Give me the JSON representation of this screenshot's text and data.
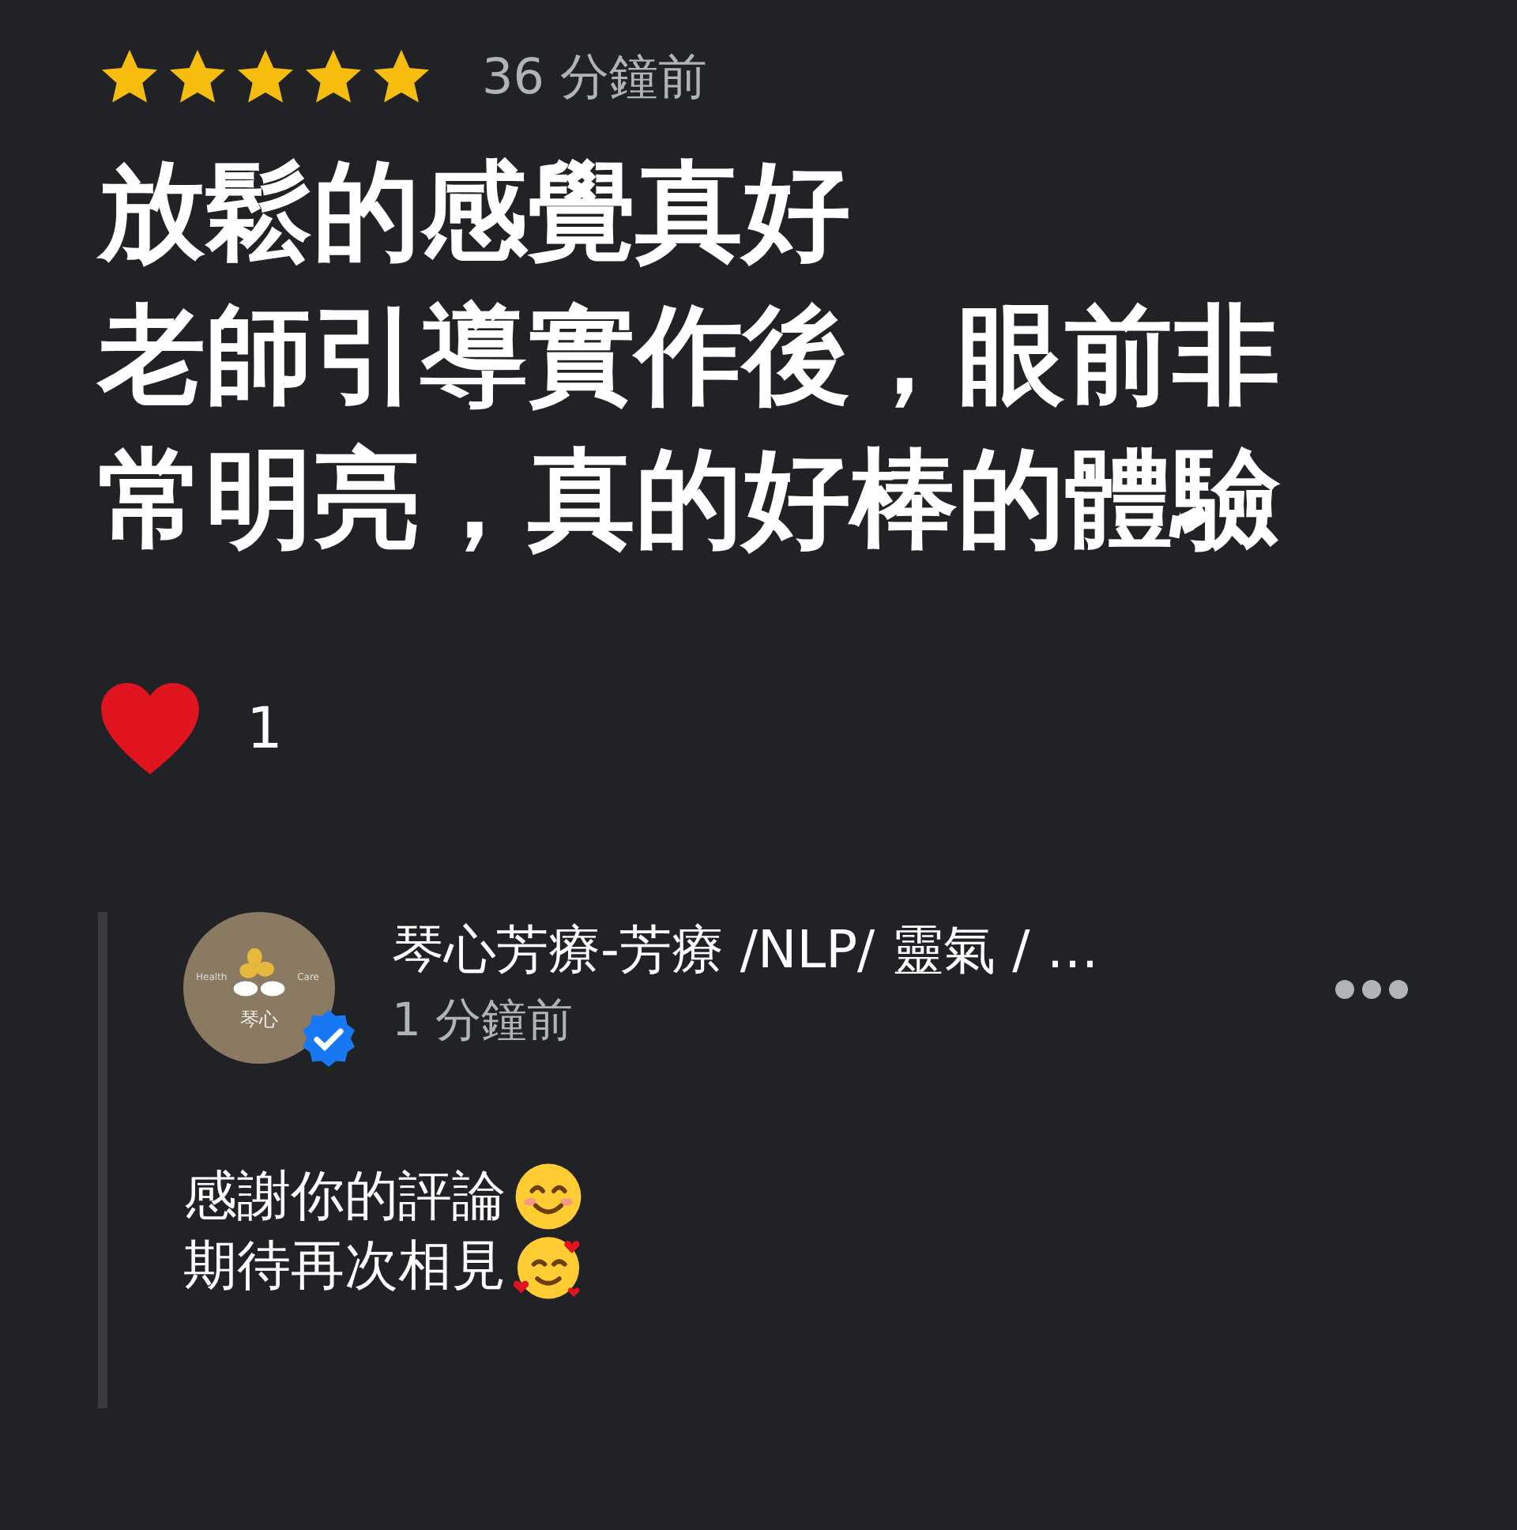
{
  "review": {
    "stars": 5,
    "time": "36 分鐘前",
    "paragraphs": [
      "放鬆的感覺真好",
      "老師引導實作後，眼前非常明亮，真的好棒的體驗"
    ],
    "reaction_count": "1"
  },
  "reply": {
    "avatar_text": {
      "left": "Health",
      "right": "Care",
      "bottom": "琴心"
    },
    "verified": true,
    "author": "琴心芳療-芳療 /NLP/ 靈氣 / …",
    "time": "1 分鐘前",
    "lines": [
      {
        "text": "感謝你的評論",
        "kind": "smile"
      },
      {
        "text": "期待再次相見",
        "kind": "hearts"
      }
    ]
  }
}
